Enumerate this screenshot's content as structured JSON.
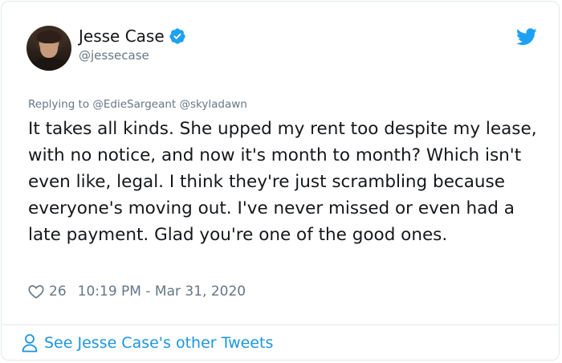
{
  "author": {
    "display_name": "Jesse Case",
    "handle": "@jessecase",
    "verified": true
  },
  "reply": {
    "prefix": "Replying to",
    "mentions": "@EdieSargeant @skyladawn"
  },
  "tweet": {
    "text": "It takes all kinds. She upped my rent too despite my lease, with no notice, and now it's month to month? Which isn't even like, legal. I think they're just scrambling because everyone's moving out. I've never missed or even had a late payment. Glad you're one of the good ones.",
    "likes": "26",
    "timestamp": "10:19 PM - Mar 31, 2020"
  },
  "footer": {
    "link_label": "See Jesse Case's other Tweets"
  },
  "icons": {
    "verified": "verified-badge-icon",
    "brand": "twitter-bird-icon",
    "like": "heart-icon",
    "profile": "person-icon"
  },
  "colors": {
    "brand_blue": "#1da1f2",
    "link_blue": "#1b95e0",
    "muted_text": "#657786",
    "primary_text": "#14171a",
    "border": "#e1e8ed"
  }
}
